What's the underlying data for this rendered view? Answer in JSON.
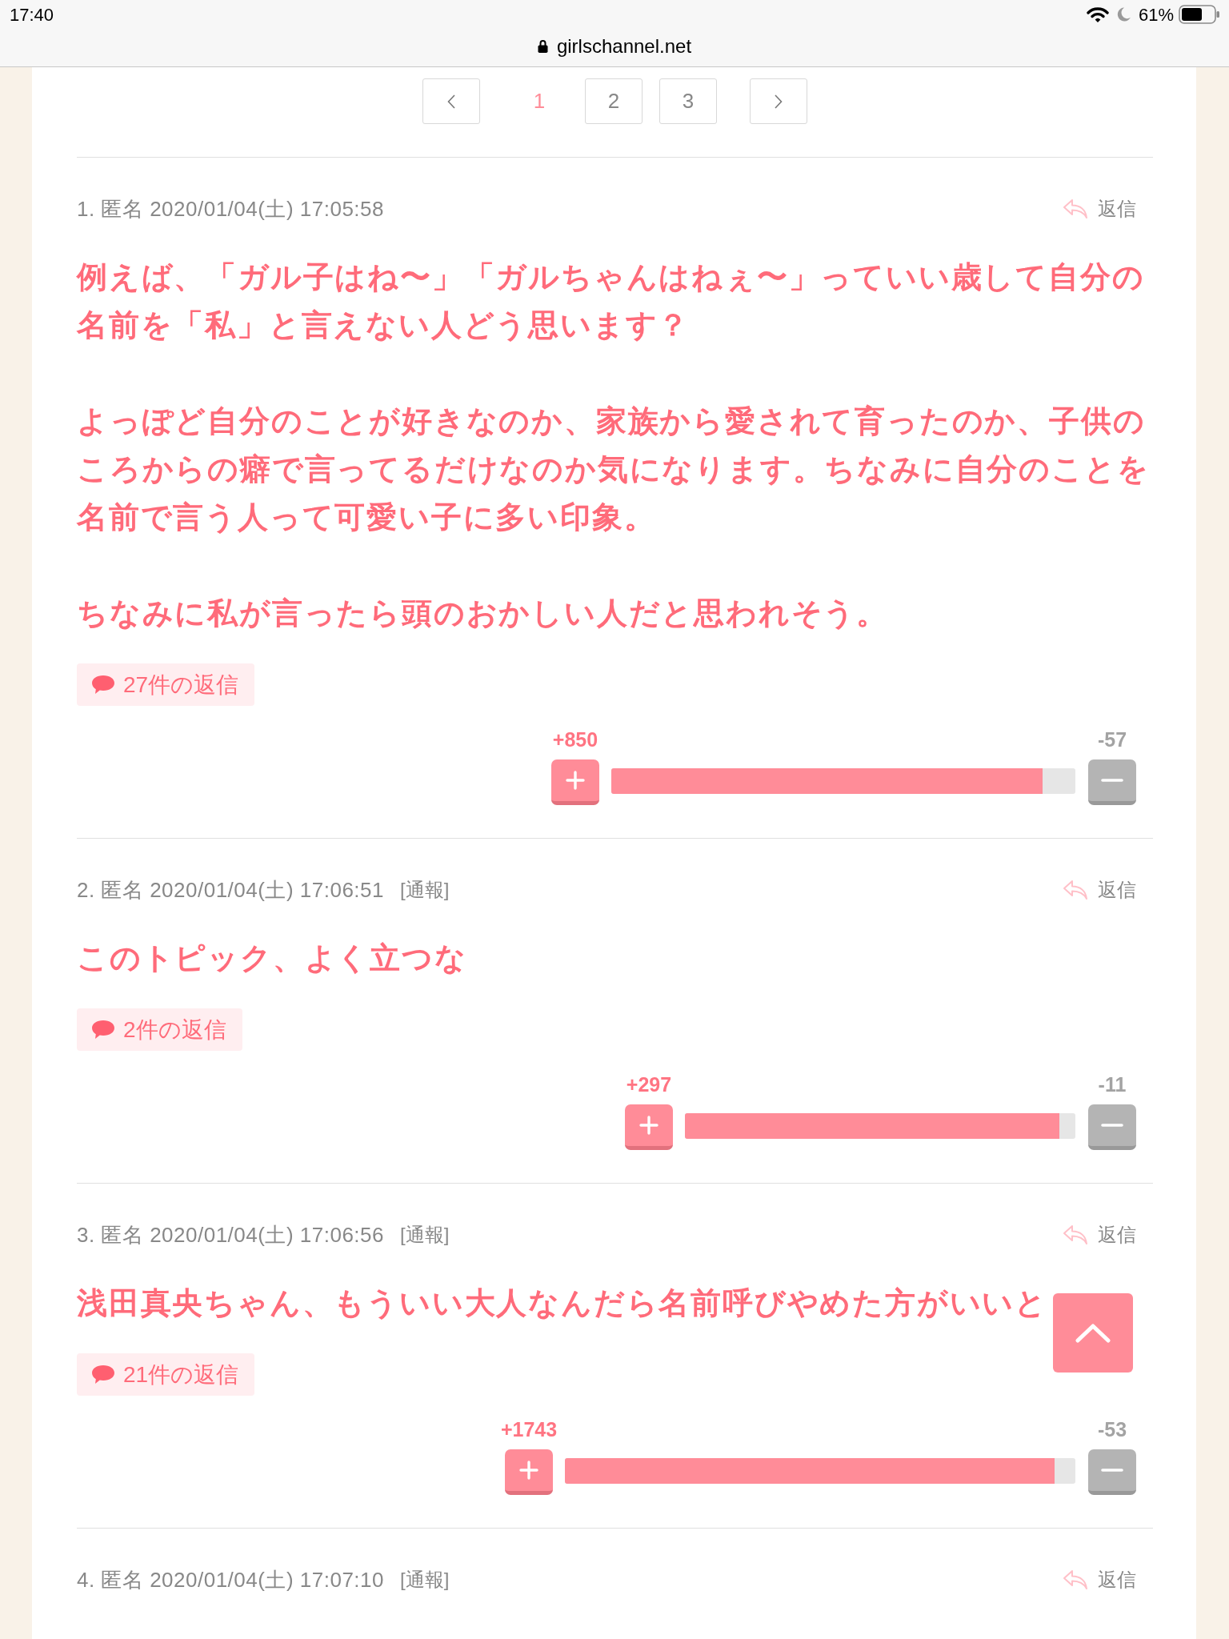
{
  "status_bar": {
    "time": "17:40",
    "battery": "61%"
  },
  "address_bar": {
    "url": "girlschannel.net"
  },
  "pagination": {
    "pages": [
      {
        "label": "1",
        "selected": true
      },
      {
        "label": "2",
        "selected": false
      },
      {
        "label": "3",
        "selected": false
      }
    ]
  },
  "comments": [
    {
      "meta": "1. 匿名 2020/01/04(土) 17:05:58",
      "reply": "返信",
      "body": [
        "例えば、「ガル子はね〜」「ガルちゃんはねぇ〜」っていい歳して自分の名前を「私」と言えない人どう思います？",
        "よっぽど自分のことが好きなのか、家族から愛されて育ったのか、子供のころからの癖で言ってるだけなのか気になります。ちなみに自分のことを名前で言う人って可愛い子に多い印象。",
        "ちなみに私が言ったら頭のおかしい人だと思われそう。"
      ],
      "replies": "27件の返信",
      "votes": {
        "plus": "+850",
        "minus": "-57",
        "level": 0.93
      }
    },
    {
      "meta": "2. 匿名 2020/01/04(土) 17:06:51",
      "report": "[通報]",
      "reply": "返信",
      "body": [
        "このトピック、よく立つな"
      ],
      "replies": "2件の返信",
      "votes": {
        "plus": "+297",
        "minus": "-11",
        "level": 0.96
      }
    },
    {
      "meta": "3. 匿名 2020/01/04(土) 17:06:56",
      "report": "[通報]",
      "reply": "返信",
      "body": [
        "浅田真央ちゃん、もういい大人なんだら名前呼びやめた方がいいと"
      ],
      "replies": "21件の返信",
      "votes": {
        "plus": "+1743",
        "minus": "-53",
        "level": 0.96
      }
    },
    {
      "meta": "4. 匿名 2020/01/04(土) 17:07:10",
      "report": "[通報]",
      "reply": "返信"
    }
  ]
}
